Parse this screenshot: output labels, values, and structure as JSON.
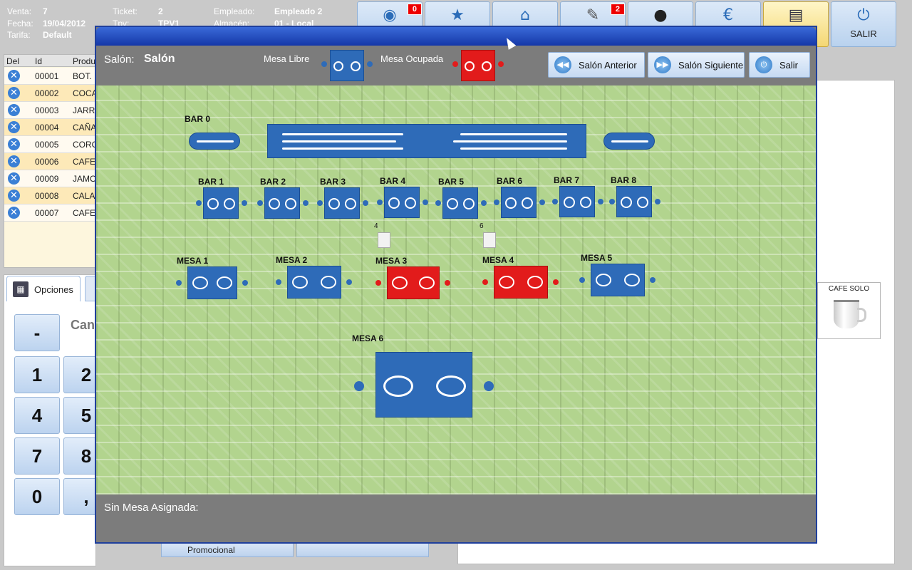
{
  "info": {
    "venta_label": "Venta:",
    "venta": "7",
    "fecha_label": "Fecha:",
    "fecha": "19/04/2012",
    "tarifa_label": "Tarifa:",
    "tarifa": "Default",
    "ticket_label": "Ticket:",
    "ticket": "2",
    "tpv_label": "Tpv:",
    "tpv": "TPV1",
    "empleado_label": "Empleado:",
    "empleado": "Empleado 2",
    "almacen_label": "Almacén:",
    "almacen": "01 - Local"
  },
  "toolbar": {
    "rss_badge": "0",
    "clip_badge": "2",
    "salir_label": "SALIR",
    "icons": [
      "rss-icon",
      "star-icon",
      "home-icon",
      "paperclip-icon",
      "user-icon",
      "euro-icon",
      "printer-icon",
      "power-icon"
    ]
  },
  "ticket_list": {
    "headers": [
      "Del",
      "Id",
      "Produ"
    ],
    "rows": [
      {
        "id": "00001",
        "prod": "BOT."
      },
      {
        "id": "00002",
        "prod": "COCA"
      },
      {
        "id": "00003",
        "prod": "JARR"
      },
      {
        "id": "00004",
        "prod": "CAÑA"
      },
      {
        "id": "00005",
        "prod": "CORO"
      },
      {
        "id": "00006",
        "prod": "CAFE"
      },
      {
        "id": "00009",
        "prod": "JAMO"
      },
      {
        "id": "00008",
        "prod": "CALA"
      },
      {
        "id": "00007",
        "prod": "CAFE"
      }
    ]
  },
  "options": {
    "tab_label": "Opciones",
    "cant_label": "Can",
    "keys": [
      "-",
      "1",
      "2",
      "4",
      "5",
      "7",
      "8",
      "0",
      ","
    ],
    "promo_label": "Promocional"
  },
  "product": {
    "label": "CAFE SOLO"
  },
  "dialog": {
    "salon_label": "Salón:",
    "salon_value": "Salón",
    "libre_label": "Mesa Libre",
    "ocupada_label": "Mesa Ocupada",
    "prev_label": "Salón Anterior",
    "next_label": "Salón Siguiente",
    "exit_label": "Salir",
    "sin_mesa_label": "Sin Mesa Asignada:",
    "tables": {
      "bar0": "BAR 0",
      "bar1": "BAR 1",
      "bar2": "BAR 2",
      "bar3": "BAR 3",
      "bar4": "BAR 4",
      "bar5": "BAR 5",
      "bar6": "BAR 6",
      "bar7": "BAR 7",
      "bar8": "BAR 8",
      "mesa1": "MESA 1",
      "mesa2": "MESA 2",
      "mesa3": "MESA 3",
      "mesa4": "MESA 4",
      "mesa5": "MESA 5",
      "mesa6": "MESA 6"
    },
    "ticket_counts": {
      "mesa3": "4",
      "mesa4": "6"
    },
    "status": {
      "mesa3": "Ocupada",
      "mesa4": "Ocupada"
    },
    "colors": {
      "libre": "#2e6bb8",
      "ocupada": "#e21b1b"
    }
  }
}
